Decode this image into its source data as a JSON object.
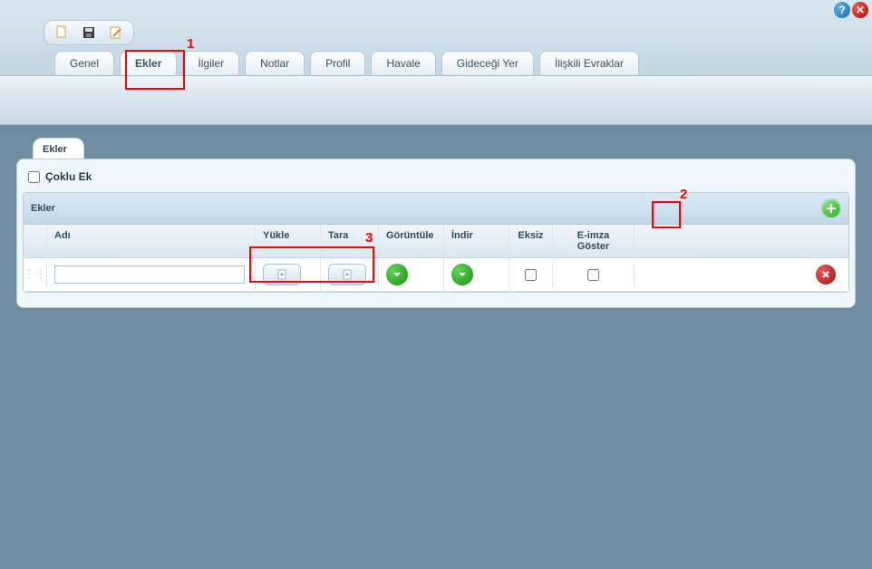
{
  "topbar": {
    "help_tooltip": "?",
    "close_tooltip": "✕"
  },
  "tabs": [
    {
      "label": "Genel",
      "active": false
    },
    {
      "label": "Ekler",
      "active": true
    },
    {
      "label": "İlgiler",
      "active": false
    },
    {
      "label": "Notlar",
      "active": false
    },
    {
      "label": "Profil",
      "active": false
    },
    {
      "label": "Havale",
      "active": false
    },
    {
      "label": "Gideceği Yer",
      "active": false
    },
    {
      "label": "İlişkili Evraklar",
      "active": false
    }
  ],
  "panel": {
    "tab_label": "Ekler",
    "coklu_ek_label": "Çoklu Ek",
    "coklu_ek_checked": false,
    "grid_title": "Ekler",
    "columns": {
      "adi": "Adı",
      "yukle": "Yükle",
      "tara": "Tara",
      "goruntule": "Görüntüle",
      "indir": "İndir",
      "eksiz": "Eksiz",
      "eimza": "E-imza Göster"
    },
    "rows": [
      {
        "adi": "",
        "eksiz": false,
        "eimza": false
      }
    ]
  },
  "annotations": {
    "n1": "1",
    "n2": "2",
    "n3": "3"
  }
}
